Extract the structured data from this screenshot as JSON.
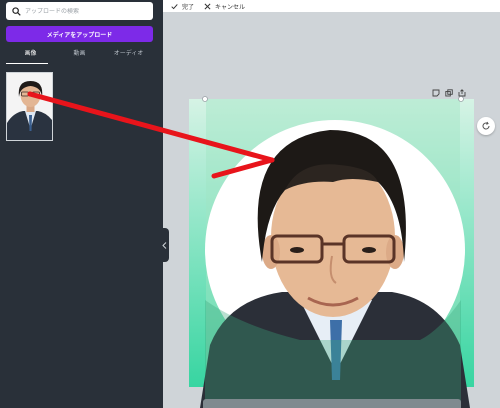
{
  "search": {
    "placeholder": "アップロードの検索"
  },
  "upload_button": {
    "label": "メディアをアップロード"
  },
  "tabs": [
    {
      "label": "画像",
      "active": true
    },
    {
      "label": "動画",
      "active": false
    },
    {
      "label": "オーディオ",
      "active": false
    }
  ],
  "toolbar": {
    "done_label": "完了",
    "cancel_label": "キャンセル"
  },
  "colors": {
    "sidebar": "#293039",
    "accent_purple": "#7d2ae8",
    "canvas_bg": "#cfd4d8",
    "frame_green": "#3dd9a5",
    "arrow_red": "#e8141b"
  },
  "icons": {
    "search": "search-icon",
    "done": "check-icon",
    "cancel": "close-icon",
    "frame_tools": [
      "note-icon",
      "duplicate-icon",
      "share-icon"
    ],
    "refresh": "refresh-icon"
  }
}
